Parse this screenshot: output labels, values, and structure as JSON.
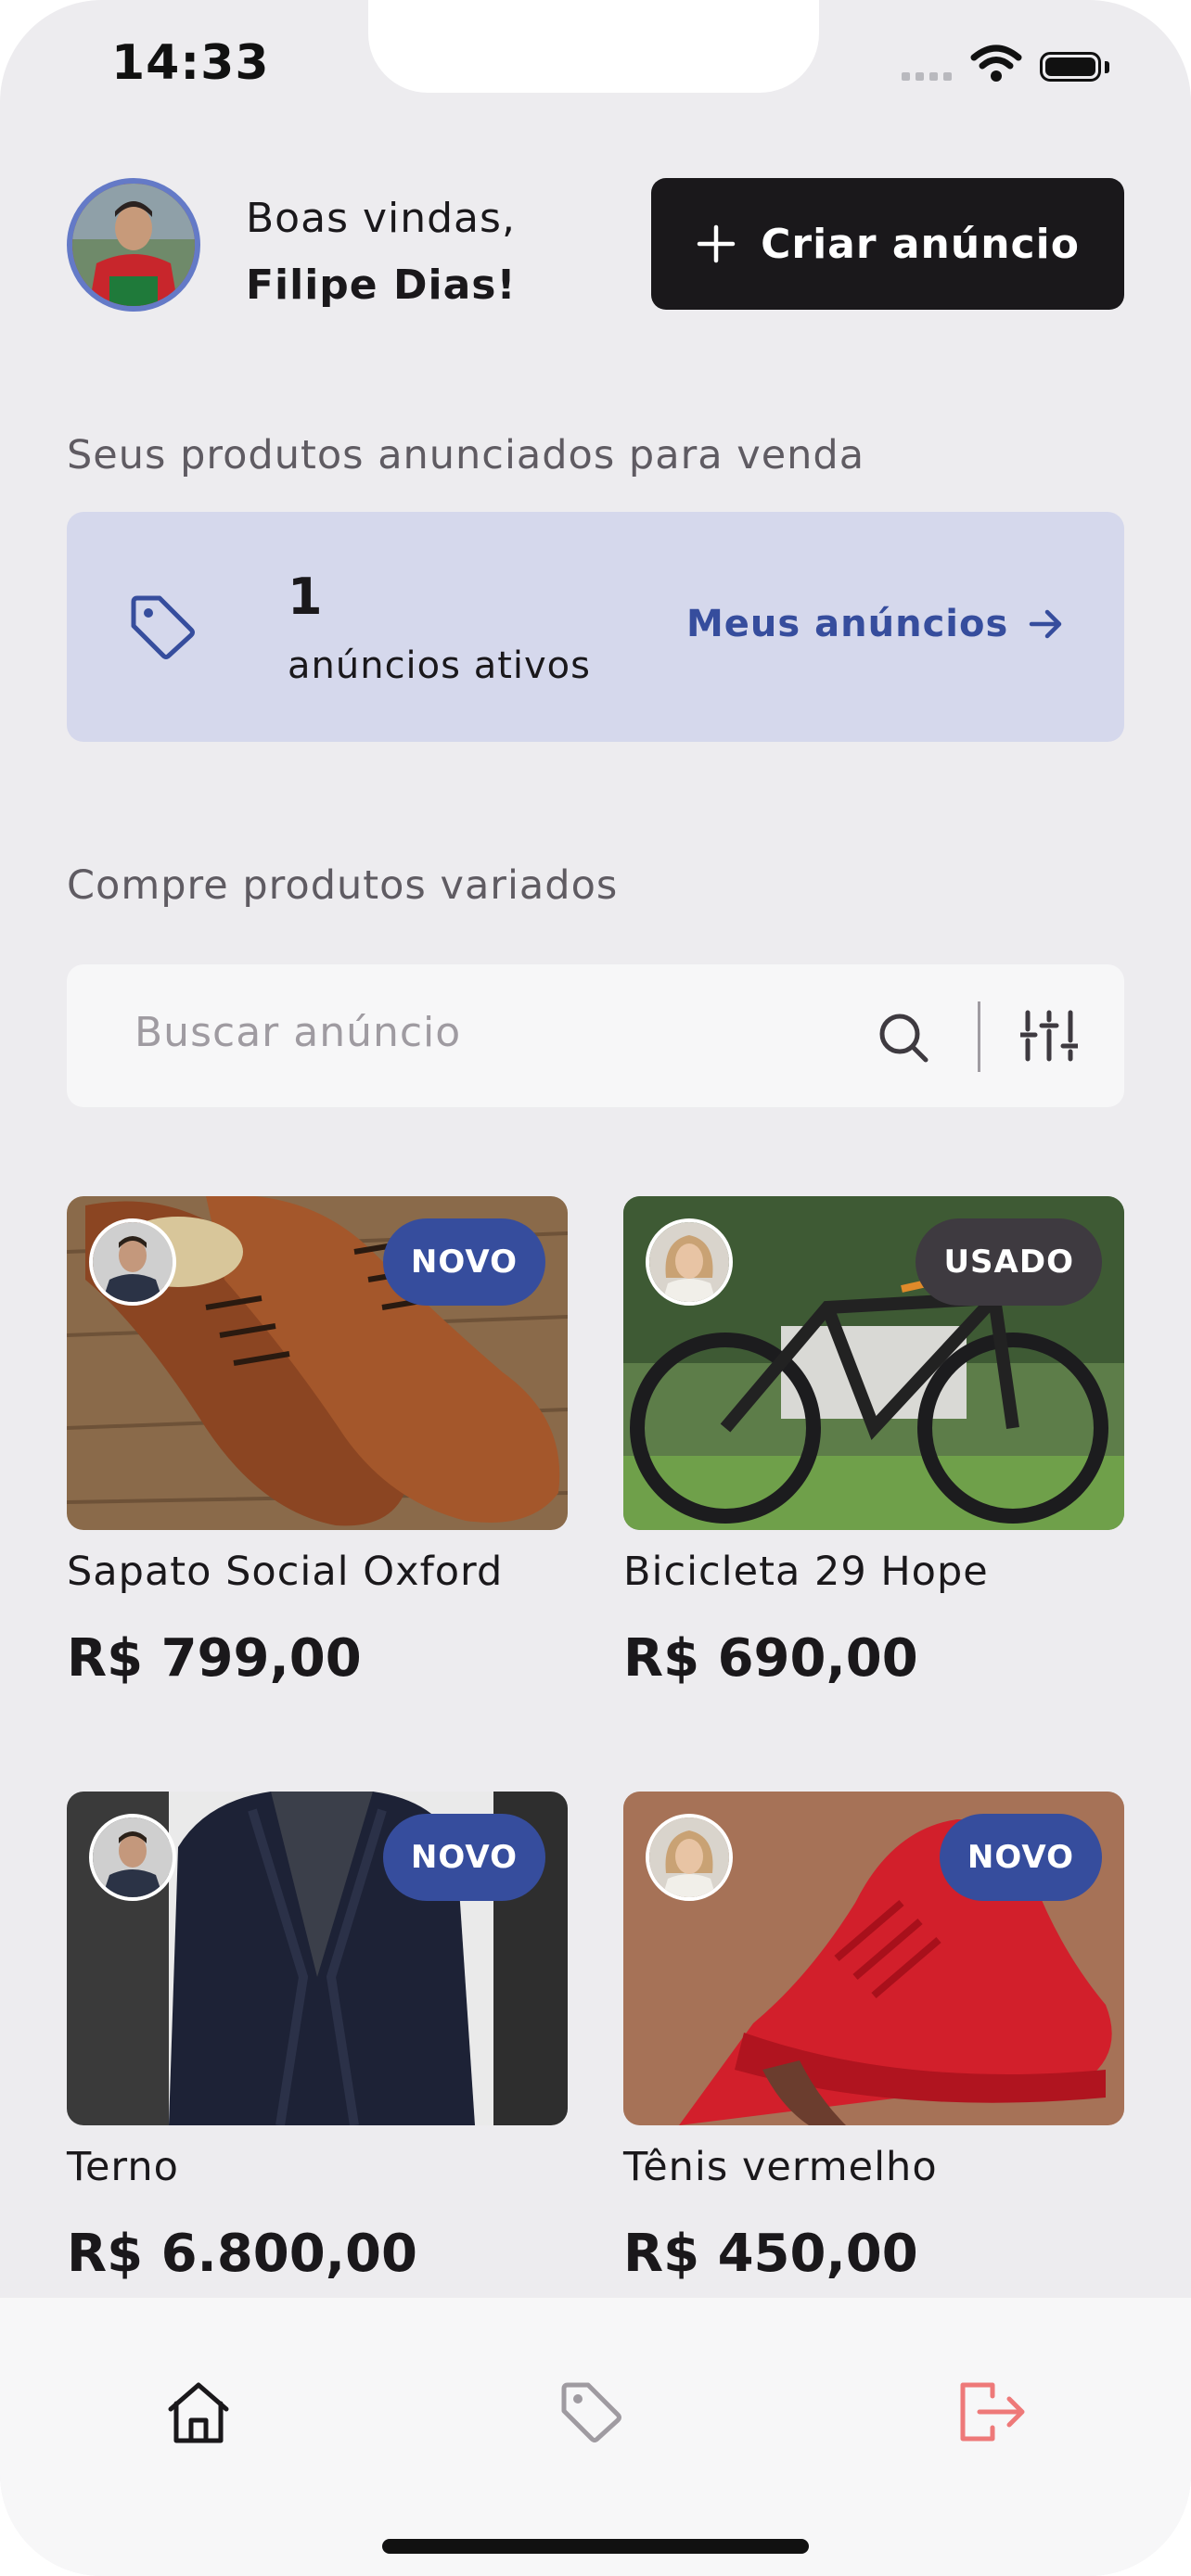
{
  "status_bar": {
    "time": "14:33"
  },
  "header": {
    "greeting": "Boas vindas,",
    "user_name": "Filipe Dias!",
    "create_button_label": "Criar anúncio"
  },
  "my_ads": {
    "section_label": "Seus produtos anunciados para venda",
    "count": "1",
    "count_label": "anúncios ativos",
    "link_label": "Meus anúncios"
  },
  "shop": {
    "section_label": "Compre produtos variados",
    "search_placeholder": "Buscar anúncio"
  },
  "products": [
    {
      "title": "Sapato Social Oxford",
      "price": "R$ 799,00",
      "condition": "NOVO"
    },
    {
      "title": "Bicicleta 29 Hope",
      "price": "R$ 690,00",
      "condition": "USADO"
    },
    {
      "title": "Terno",
      "price": "R$ 6.800,00",
      "condition": "NOVO"
    },
    {
      "title": "Tênis vermelho",
      "price": "R$ 450,00",
      "condition": "NOVO"
    }
  ],
  "bottom_nav": [
    "home-icon",
    "tag-icon",
    "logout-icon"
  ],
  "colors": {
    "brand_blue": "#364D9D",
    "light_blue": "#647AC7",
    "dark": "#1A181B",
    "logout_red": "#EE7979"
  }
}
